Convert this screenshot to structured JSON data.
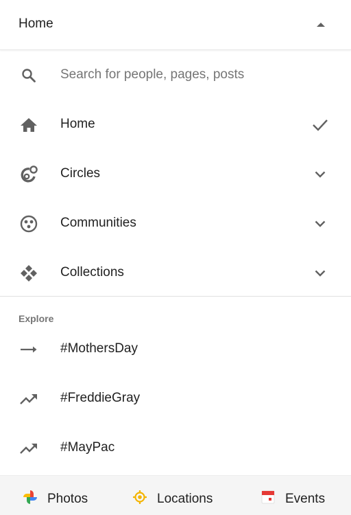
{
  "header": {
    "title": "Home",
    "collapse_icon": "arrow-drop-up-icon"
  },
  "search": {
    "placeholder": "Search for people, pages, posts",
    "icon": "search-icon"
  },
  "nav": {
    "items": [
      {
        "label": "Home",
        "icon": "home-icon",
        "trailing": "check-icon",
        "selected": true
      },
      {
        "label": "Circles",
        "icon": "circles-icon",
        "trailing": "chevron-down-icon"
      },
      {
        "label": "Communities",
        "icon": "communities-icon",
        "trailing": "chevron-down-icon"
      },
      {
        "label": "Collections",
        "icon": "collections-icon",
        "trailing": "chevron-down-icon"
      }
    ]
  },
  "explore": {
    "title": "Explore",
    "items": [
      {
        "label": "#MothersDay",
        "icon": "arrow-right-icon"
      },
      {
        "label": "#FreddieGray",
        "icon": "trending-up-icon"
      },
      {
        "label": "#MayPac",
        "icon": "trending-up-icon"
      }
    ]
  },
  "footer": {
    "tabs": [
      {
        "label": "Photos",
        "icon": "photos-pinwheel-icon"
      },
      {
        "label": "Locations",
        "icon": "location-target-icon"
      },
      {
        "label": "Events",
        "icon": "calendar-icon"
      }
    ]
  },
  "colors": {
    "icon_gray": "#616161",
    "text": "#212121",
    "secondary_text": "#757575",
    "footer_bg": "#f5f5f5",
    "locations_yellow": "#f4b400",
    "events_red": "#e53935"
  }
}
